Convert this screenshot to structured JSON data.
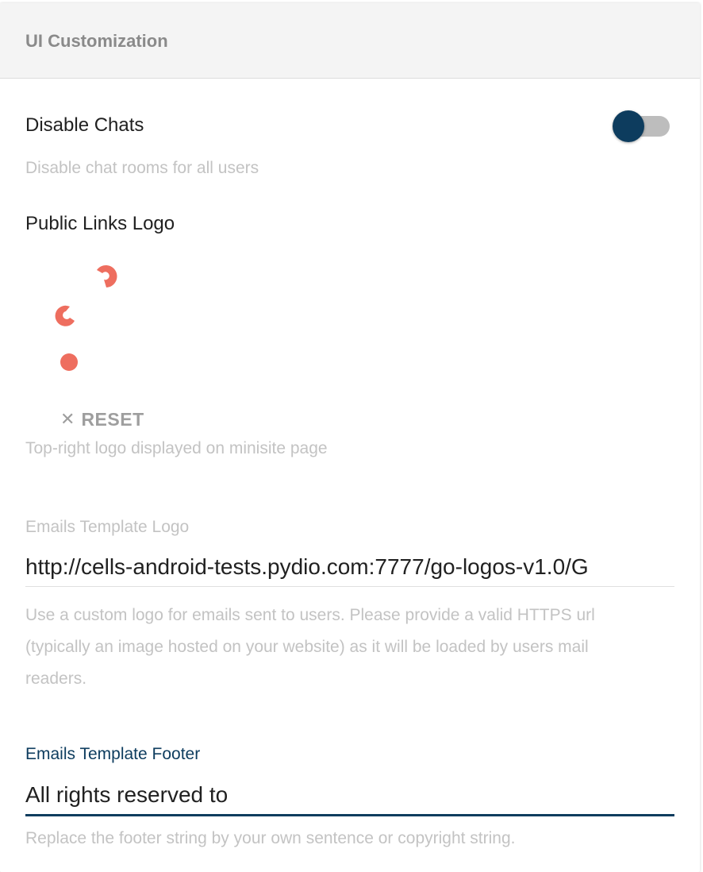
{
  "panel": {
    "title": "UI Customization"
  },
  "disable_chats": {
    "label": "Disable Chats",
    "description": "Disable chat rooms for all users",
    "enabled": false
  },
  "public_links_logo": {
    "label": "Public Links Logo",
    "reset_icon": "close-icon",
    "reset_label": "RESET",
    "description": "Top-right logo displayed on minisite page"
  },
  "emails_template_logo": {
    "label": "Emails Template Logo",
    "value": "http://cells-android-tests.pydio.com:7777/go-logos-v1.0/G",
    "description_lines": [
      "Use a custom logo for emails sent to users. Please provide a valid HTTPS url",
      "(typically an image hosted on your website) as it will be loaded by users mail",
      "readers."
    ]
  },
  "emails_template_footer": {
    "label": "Emails Template Footer",
    "value": "All rights reserved to",
    "description": "Replace the footer string by your own sentence or copyright string."
  },
  "colors": {
    "primary": "#0d3c5e",
    "logo_accent": "#ee6e5f",
    "hint_text": "#c3c3c3",
    "label_text": "#212121",
    "header_bg": "#f4f4f4"
  }
}
